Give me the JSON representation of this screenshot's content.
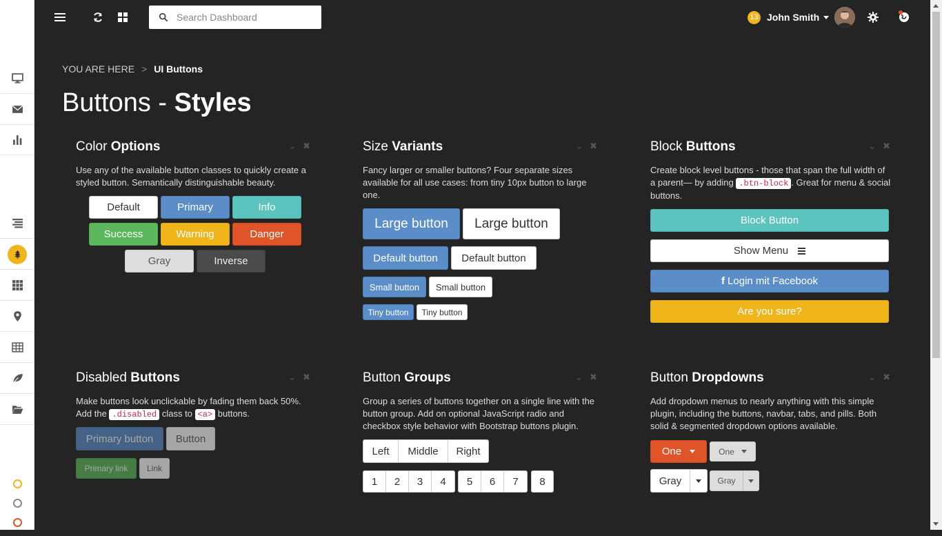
{
  "search": {
    "placeholder": "Search Dashboard"
  },
  "user": {
    "badge": "13",
    "name": "John Smith"
  },
  "breadcrumb": {
    "prefix": "YOU ARE HERE",
    "sep": ">",
    "current": "UI Buttons"
  },
  "page": {
    "title_light": "Buttons -",
    "title_bold": "Styles"
  },
  "panels": {
    "color": {
      "title_light": "Color",
      "title_bold": "Options",
      "desc": "Use any of the available button classes to quickly create a styled button. Semantically distinguishable beauty.",
      "buttons": {
        "default": "Default",
        "primary": "Primary",
        "info": "Info",
        "success": "Success",
        "warning": "Warning",
        "danger": "Danger",
        "gray": "Gray",
        "inverse": "Inverse"
      }
    },
    "size": {
      "title_light": "Size",
      "title_bold": "Variants",
      "desc": "Fancy larger or smaller buttons? Four separate sizes available for all use cases: from tiny 10px button to large one.",
      "large": "Large button",
      "default": "Default button",
      "small": "Small button",
      "tiny": "Tiny button"
    },
    "block": {
      "title_light": "Block",
      "title_bold": "Buttons",
      "desc1": "Create block level buttons - those that span the full width of a parent— by adding ",
      "code": ".btn-block",
      "desc2": ". Great for menu & social buttons.",
      "b1": "Block Button",
      "b2": "Show Menu",
      "b3": "Login mit Facebook",
      "b4": "Are you sure?"
    },
    "disabled": {
      "title_light": "Disabled",
      "title_bold": "Buttons",
      "desc1": "Make buttons look unclickable by fading them back 50%. Add the ",
      "code1": ".disabled",
      "desc2": " class to ",
      "code2": "<a>",
      "desc3": " buttons.",
      "primary_button": "Primary button",
      "button": "Button",
      "primary_link": "Primary link",
      "link": "Link"
    },
    "groups": {
      "title_light": "Button",
      "title_bold": "Groups",
      "desc": "Group a series of buttons together on a single line with the button group. Add on optional JavaScript radio and checkbox style behavior with Bootstrap buttons plugin.",
      "lmr": [
        "Left",
        "Middle",
        "Right"
      ],
      "g1": [
        "1",
        "2",
        "3",
        "4"
      ],
      "g2": [
        "5",
        "6",
        "7"
      ],
      "g3": [
        "8"
      ]
    },
    "dropdowns": {
      "title_light": "Button",
      "title_bold": "Dropdowns",
      "desc": "Add dropdown menus to nearly anything with this simple plugin, including the buttons, navbar, tabs, and pills. Both solid & segmented dropdown options available.",
      "one_big": "One",
      "one_small": "One",
      "gray_big": "Gray",
      "gray_small": "Gray"
    }
  },
  "colors": {
    "accent": "#f0b51b",
    "primary": "#5b8ec9",
    "info": "#5bc4bf",
    "success": "#5cb85c",
    "danger": "#e0542a"
  }
}
